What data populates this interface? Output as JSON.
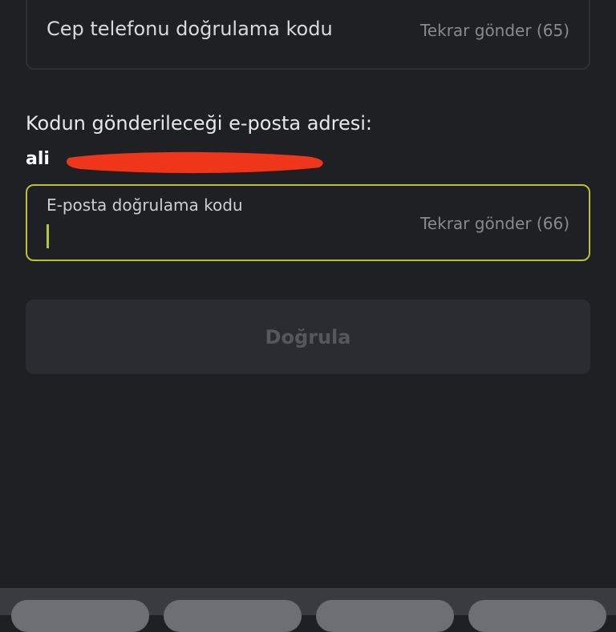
{
  "phone_verification": {
    "label": "Cep telefonu doğrulama kodu",
    "resend_label": "Tekrar gönder (65)"
  },
  "email_section": {
    "label": "Kodun gönderileceği e-posta adresi:",
    "address_visible": "ali"
  },
  "email_verification": {
    "placeholder": "E-posta doğrulama kodu",
    "resend_label": "Tekrar gönder (66)"
  },
  "verify_button": {
    "label": "Doğrula"
  },
  "colors": {
    "background": "#1f2024",
    "accent": "#b7c33b",
    "redaction": "#f0361a"
  }
}
